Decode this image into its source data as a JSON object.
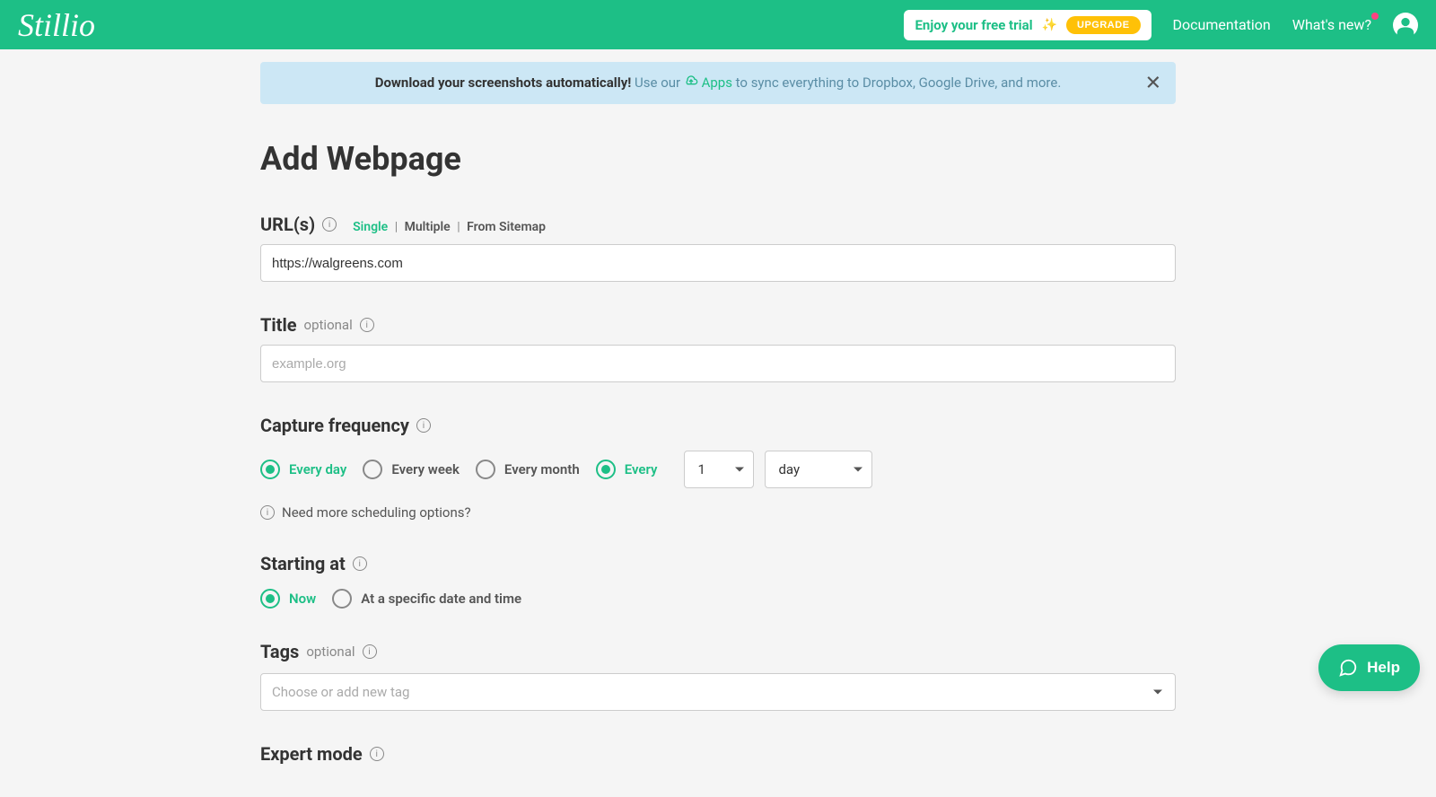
{
  "header": {
    "logo": "Stillio",
    "trial_text": "Enjoy your free trial",
    "upgrade_btn": "UPGRADE",
    "nav": {
      "documentation": "Documentation",
      "whats_new": "What's new?"
    }
  },
  "banner": {
    "bold": "Download your screenshots automatically!",
    "text1": " Use our ",
    "link": " Apps ",
    "text2": "to sync everything to Dropbox, Google Drive, and more."
  },
  "page": {
    "title": "Add Webpage"
  },
  "url_section": {
    "label": "URL(s)",
    "modes": {
      "single": "Single",
      "multiple": "Multiple",
      "from_sitemap": "From Sitemap"
    },
    "value": "https://walgreens.com"
  },
  "title_section": {
    "label": "Title",
    "optional": "optional",
    "placeholder": "example.org"
  },
  "frequency": {
    "label": "Capture frequency",
    "options": {
      "every_day": "Every day",
      "every_week": "Every week",
      "every_month": "Every month",
      "every": "Every"
    },
    "interval_value": "1",
    "interval_unit": "day",
    "note": "Need more scheduling options?"
  },
  "starting": {
    "label": "Starting at",
    "options": {
      "now": "Now",
      "specific": "At a specific date and time"
    }
  },
  "tags": {
    "label": "Tags",
    "optional": "optional",
    "placeholder": "Choose or add new tag"
  },
  "expert": {
    "label": "Expert mode"
  },
  "help": {
    "label": "Help"
  }
}
